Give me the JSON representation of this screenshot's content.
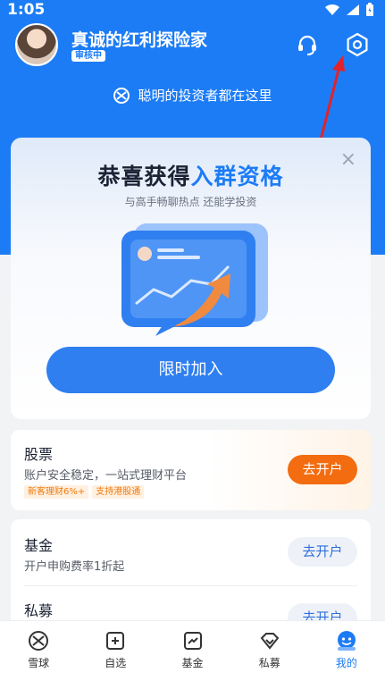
{
  "status_bar": {
    "time": "1:05"
  },
  "profile": {
    "username": "真诚的红利探险家",
    "badge": "审核中"
  },
  "slogan": "聪明的投资者都在这里",
  "promo": {
    "title_prefix": "恭喜获得",
    "title_highlight": "入群资格",
    "subtitle": "与高手畅聊热点 还能学投资",
    "cta": "限时加入",
    "close": "×"
  },
  "stock_card": {
    "name": "股票",
    "desc": "账户安全稳定，一站式理财平台",
    "tags": [
      "新客理财6%+",
      "支持港股通"
    ],
    "button": "去开户"
  },
  "fund_card": {
    "name": "基金",
    "desc": "开户申购费率1折起",
    "button": "去开户"
  },
  "private_card": {
    "name": "私募",
    "button": "去开户"
  },
  "tabbar": [
    {
      "label": "雪球",
      "icon": "snowball-icon"
    },
    {
      "label": "自选",
      "icon": "add-square-icon"
    },
    {
      "label": "基金",
      "icon": "chart-icon"
    },
    {
      "label": "私募",
      "icon": "diamond-icon"
    },
    {
      "label": "我的",
      "icon": "profile-icon",
      "active": true
    }
  ],
  "colors": {
    "primary": "#1c7cf5",
    "accent_orange": "#f36c10"
  }
}
